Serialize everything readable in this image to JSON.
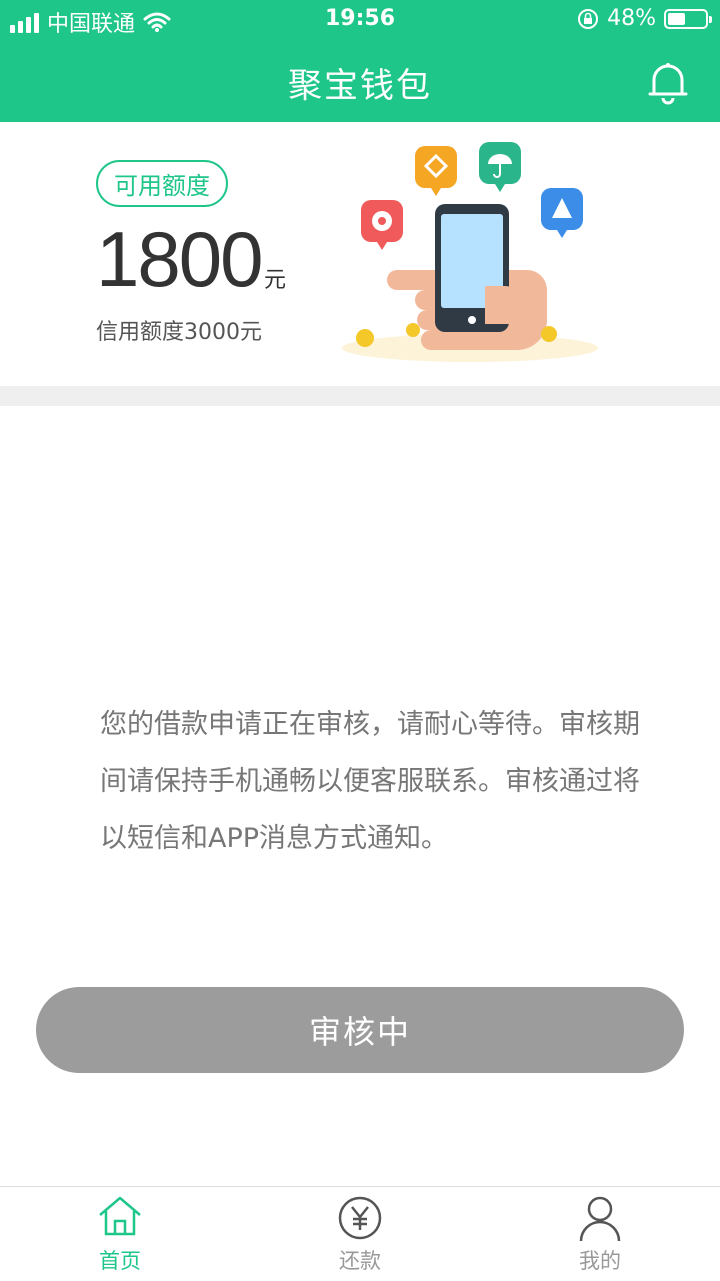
{
  "status_bar": {
    "carrier": "中国联通",
    "time": "19:56",
    "battery": "48%",
    "battery_level": 0.48
  },
  "navbar": {
    "title": "聚宝钱包",
    "bell_icon": "bell-icon"
  },
  "credit": {
    "badge": "可用额度",
    "amount": "1800",
    "unit": "元",
    "limit": "信用额度3000元"
  },
  "message": "您的借款申请正在审核，请耐心等待。审核期间请保持手机通畅以便客服联系。审核通过将以短信和APP消息方式通知。",
  "review_button": "审核中",
  "tabs": [
    {
      "label": "首页",
      "icon": "home-icon",
      "active": true
    },
    {
      "label": "还款",
      "icon": "yen-icon",
      "active": false
    },
    {
      "label": "我的",
      "icon": "user-icon",
      "active": false
    }
  ],
  "colors": {
    "primary": "#1fc68a",
    "button_disabled": "#9c9c9c",
    "text_muted": "#777777"
  }
}
